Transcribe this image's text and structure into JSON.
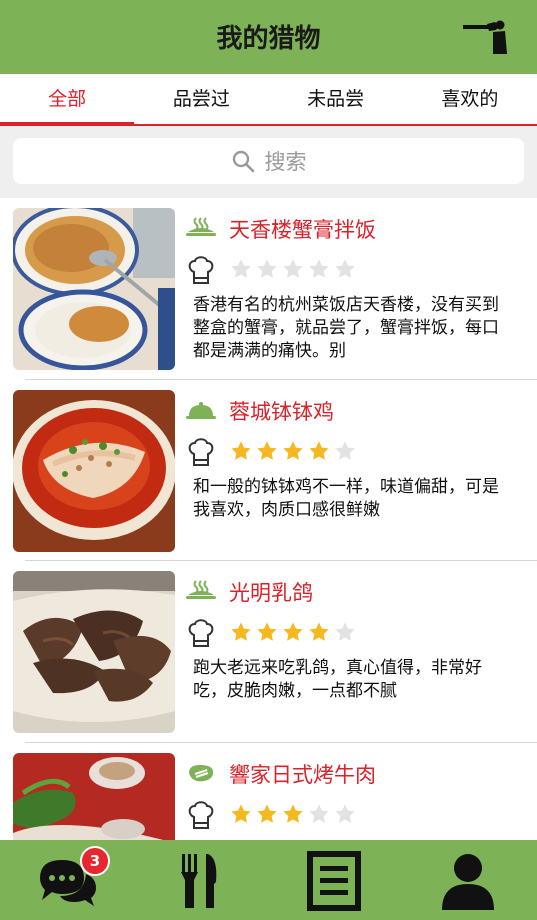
{
  "header": {
    "title": "我的猎物"
  },
  "tabs": [
    {
      "label": "全部",
      "active": true
    },
    {
      "label": "品尝过",
      "active": false
    },
    {
      "label": "未品尝",
      "active": false
    },
    {
      "label": "喜欢的",
      "active": false
    }
  ],
  "search": {
    "placeholder": "搜索"
  },
  "items": [
    {
      "name": "天香楼蟹膏拌饭",
      "status_icon": "steaming-dish-icon",
      "rating": 0,
      "max_rating": 5,
      "description": "香港有名的杭州菜饭店天香楼，没有买到整盒的蟹膏，就品尝了，蟹膏拌饭，每口都是满满的痛快。别"
    },
    {
      "name": "蓉城钵钵鸡",
      "status_icon": "covered-dish-icon",
      "rating": 4,
      "max_rating": 5,
      "description": "和一般的钵钵鸡不一样，味道偏甜，可是我喜欢，肉质口感很鲜嫩"
    },
    {
      "name": "光明乳鸽",
      "status_icon": "steaming-dish-icon",
      "rating": 4,
      "max_rating": 5,
      "description": "跑大老远来吃乳鸽，真心值得，非常好吃，皮脆肉嫩，一点都不腻"
    },
    {
      "name": "響家日式烤牛肉",
      "status_icon": "steak-icon",
      "rating": 3,
      "max_rating": 5,
      "description": ""
    }
  ],
  "bottom_nav": {
    "messages_badge": "3",
    "buttons": [
      "chat-icon",
      "fork-knife-icon",
      "list-icon",
      "user-icon"
    ]
  },
  "colors": {
    "brand_green": "#7db257",
    "accent_red": "#d8232a",
    "star_gold": "#f5b820",
    "star_empty": "#e2e2e2"
  }
}
